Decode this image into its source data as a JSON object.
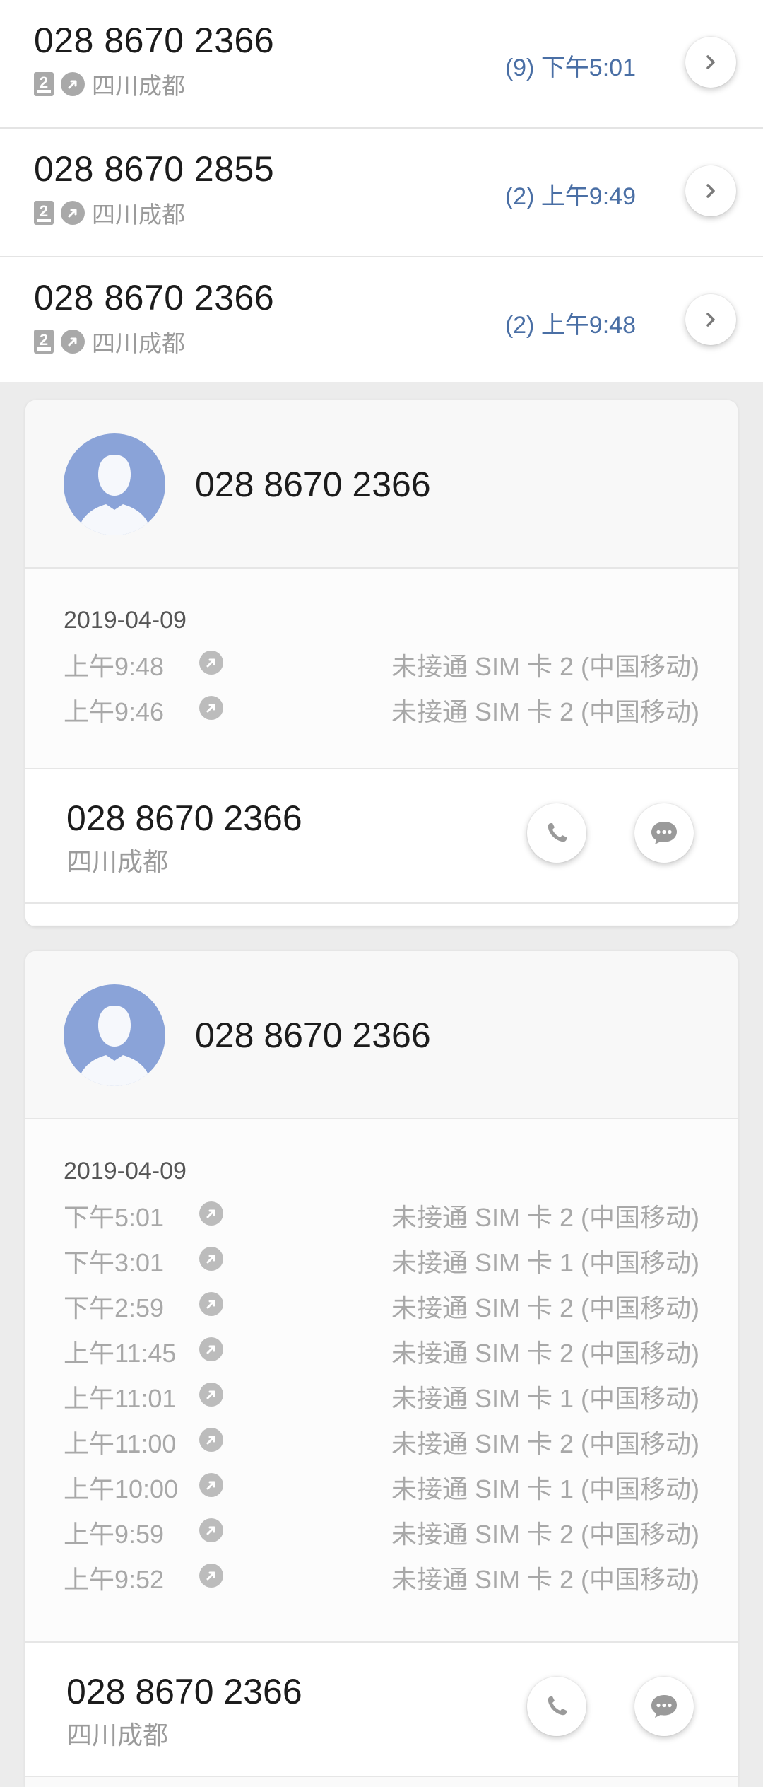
{
  "call_list": [
    {
      "number": "028 8670 2366",
      "location": "四川成都",
      "sim": "2",
      "meta": "(9) 下午5:01"
    },
    {
      "number": "028 8670 2855",
      "location": "四川成都",
      "sim": "2",
      "meta": "(2) 上午9:49"
    },
    {
      "number": "028 8670 2366",
      "location": "四川成都",
      "sim": "2",
      "meta": "(2) 上午9:48"
    }
  ],
  "cards": [
    {
      "title": "028 8670 2366",
      "date": "2019-04-09",
      "records": [
        {
          "time": "上午9:48",
          "status": "未接通 SIM 卡 2 (中国移动)"
        },
        {
          "time": "上午9:46",
          "status": "未接通 SIM 卡 2 (中国移动)"
        }
      ],
      "footer_number": "028 8670 2366",
      "footer_location": "四川成都"
    },
    {
      "title": "028 8670 2366",
      "date": "2019-04-09",
      "records": [
        {
          "time": "下午5:01",
          "status": "未接通 SIM 卡 2 (中国移动)"
        },
        {
          "time": "下午3:01",
          "status": "未接通 SIM 卡 1 (中国移动)"
        },
        {
          "time": "下午2:59",
          "status": "未接通 SIM 卡 2 (中国移动)"
        },
        {
          "time": "上午11:45",
          "status": "未接通 SIM 卡 2 (中国移动)"
        },
        {
          "time": "上午11:01",
          "status": "未接通 SIM 卡 1 (中国移动)"
        },
        {
          "time": "上午11:00",
          "status": "未接通 SIM 卡 2 (中国移动)"
        },
        {
          "time": "上午10:00",
          "status": "未接通 SIM 卡 1 (中国移动)"
        },
        {
          "time": "上午9:59",
          "status": "未接通 SIM 卡 2 (中国移动)"
        },
        {
          "time": "上午9:52",
          "status": "未接通 SIM 卡 2 (中国移动)"
        }
      ],
      "footer_number": "028 8670 2366",
      "footer_location": "四川成都"
    }
  ],
  "icons": {
    "sim": "sim-card-icon",
    "outgoing": "outgoing-call-icon",
    "chevron": "chevron-right-icon",
    "phone": "phone-icon",
    "message": "message-icon",
    "avatar": "contact-avatar-icon"
  },
  "colors": {
    "meta_blue": "#4a6fa5",
    "avatar_blue": "#8aa3d8",
    "muted_text": "#a8a8a8"
  }
}
